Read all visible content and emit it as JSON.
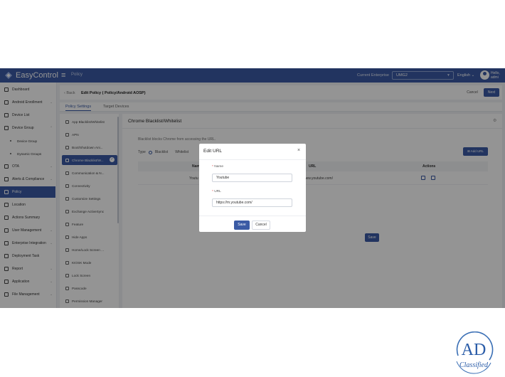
{
  "topbar": {
    "app_name": "EasyControl",
    "menu_title": "Policy",
    "enterprise_label": "Current Enterprise",
    "enterprise_value": "UMG2",
    "language": "English",
    "greeting": "Hello, admi",
    "brand_color": "#3b5ba5"
  },
  "sidebar": {
    "items": [
      {
        "label": "Dashboard",
        "icon": "dashboard-icon"
      },
      {
        "label": "Android Enrollment",
        "icon": "android-icon"
      },
      {
        "label": "Device List",
        "icon": "device-list-icon"
      },
      {
        "label": "Device Group",
        "icon": "device-group-icon"
      },
      {
        "label": "Device Group",
        "icon": "dot"
      },
      {
        "label": "Dynamic Groups",
        "icon": "dot"
      },
      {
        "label": "OTA",
        "icon": "ota-icon"
      },
      {
        "label": "Alerts & Compliance",
        "icon": "alert-icon"
      },
      {
        "label": "Policy",
        "icon": "policy-icon"
      },
      {
        "label": "Location",
        "icon": "location-icon"
      },
      {
        "label": "Actions Summary",
        "icon": "actions-icon"
      },
      {
        "label": "User Management",
        "icon": "user-icon"
      },
      {
        "label": "Enterprise Integration",
        "icon": "integration-icon"
      },
      {
        "label": "Deployment Task",
        "icon": "task-icon"
      },
      {
        "label": "Report",
        "icon": "report-icon"
      },
      {
        "label": "Application",
        "icon": "application-icon"
      },
      {
        "label": "File Management",
        "icon": "file-icon"
      }
    ]
  },
  "header": {
    "back_label": "Back",
    "title": "Edit Policy   ( Policy/Android AOSP)",
    "cancel_label": "Cancel",
    "next_label": "Next"
  },
  "tabs": {
    "policy_settings": "Policy Settings",
    "target_devices": "Target Devices"
  },
  "subnav": {
    "items": [
      {
        "label": "App Blacklist/Whitelist"
      },
      {
        "label": "APN"
      },
      {
        "label": "Boot/Shutdown Ani..."
      },
      {
        "label": "Chrome Blacklist/W..."
      },
      {
        "label": "Communication & N..."
      },
      {
        "label": "Connectivity"
      },
      {
        "label": "Customize Settings"
      },
      {
        "label": "Exchange ActiveSync"
      },
      {
        "label": "Feature"
      },
      {
        "label": "Hide Apps"
      },
      {
        "label": "Home/Lock Screen ..."
      },
      {
        "label": "KIOSK Mode"
      },
      {
        "label": "Lock Screen"
      },
      {
        "label": "Passcode"
      },
      {
        "label": "Permission Manager"
      }
    ]
  },
  "panel": {
    "title": "Chrome Blacklist/Whitelist",
    "description": "Blacklist blocks Chrome from accessing the URL.",
    "type_label": "Type",
    "type_blacklist": "Blacklist",
    "type_whitelist": "Whitelist",
    "add_url_label": "Add URL",
    "columns": [
      "Name",
      "URL",
      "Actions"
    ],
    "rows": [
      {
        "name": "Youtu",
        "url": "www.youtube.com/"
      }
    ],
    "save_label": "Save"
  },
  "modal": {
    "title": "Edit URL",
    "name_label": "Name",
    "name_value": "Youtube",
    "url_label": "URL",
    "url_value": "https://m.youtube.com/",
    "save_label": "Save",
    "cancel_label": "Cancel"
  },
  "watermark": {
    "logo_text": "AD",
    "logo_subtext": "Classified"
  }
}
